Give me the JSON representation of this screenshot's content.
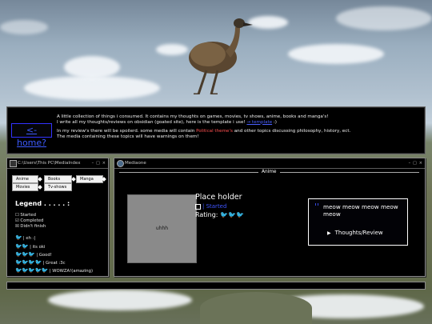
{
  "banner": {
    "home_label": "<- home?",
    "intro_1a": "A little collection of things i consumed. It contains my thoughts on games, movies, tv shows, anime, books and manga's!",
    "intro_1b": "I write all my thoughts/reviews on obsidian (goated site), here is the template i use!",
    "template_link": "→ template",
    "intro_1c": ":)",
    "intro_2a": "In my review's there will be spoilerd. some media will contain",
    "warn_text": "Political theme's",
    "intro_2b": "and other topics discussing philosophy, history, ect.",
    "intro_3": "The media containing these topics will have warnings on them!"
  },
  "index_window": {
    "title": "C:\\Users\\This PC\\MediaIndex",
    "buttons": [
      "Anime",
      "Books",
      "Manga",
      "Movies",
      "Tv-shows"
    ],
    "legend_title": "Legend . . . . . :",
    "legend_items": [
      "☐ Started",
      "☑ Completed",
      "☒ Didn't finish"
    ],
    "rating_icon": "emu",
    "ratings": [
      {
        "icons": "🐦",
        "label": "| eh :|"
      },
      {
        "icons": "🐦🐦",
        "label": "| its oki"
      },
      {
        "icons": "🐦🐦🐦",
        "label": "| Good!"
      },
      {
        "icons": "🐦🐦🐦🐦",
        "label": "| Great :3c"
      },
      {
        "icons": "🐦🐦🐦🐦🐦",
        "label": "| WOWZA!(amazing)"
      }
    ]
  },
  "media_window": {
    "title": "Mediaone",
    "section": "Anime",
    "thumb_text": "uhhh",
    "item_title": "Place holder",
    "status_label": "| Started",
    "rating_label": "Rating:",
    "rating_icons": "🐦🐦🐦",
    "quote_mark": "''",
    "quote": "meow meow meow meow meow",
    "review_link": "Thoughts/Review"
  },
  "colors": {
    "link": "#3e55ff",
    "warn": "#ff5050",
    "window_bg": "#000000"
  }
}
